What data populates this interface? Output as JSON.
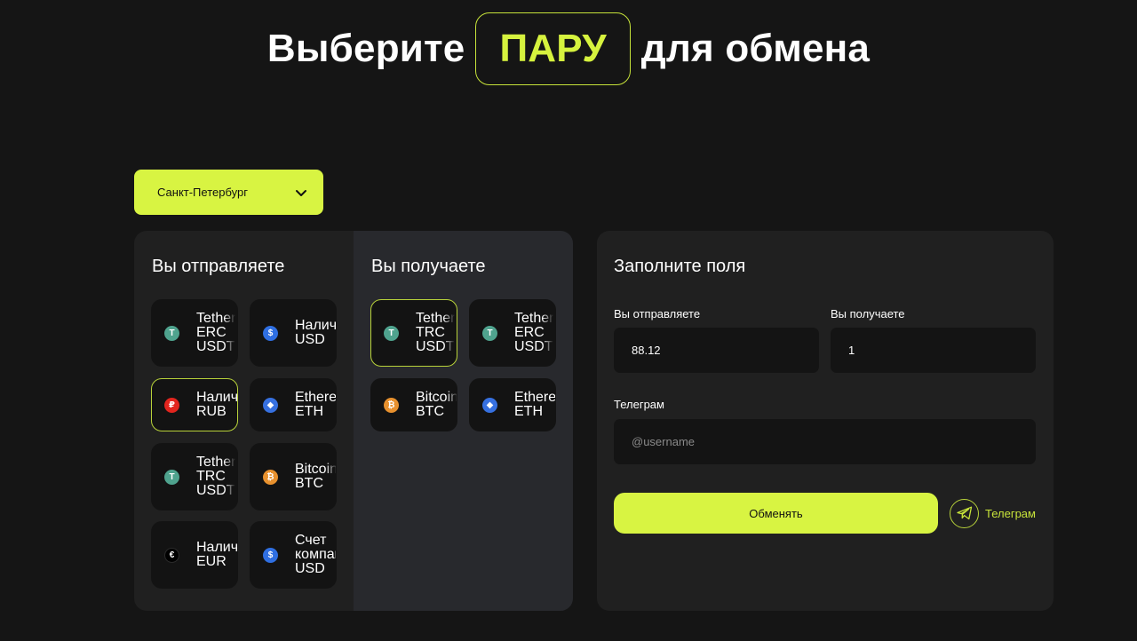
{
  "header": {
    "title_before": "Выберите",
    "title_highlight": "ПАРУ",
    "title_after": "для обмена"
  },
  "city_select": {
    "value": "Санкт-Петербург"
  },
  "send": {
    "title": "Вы отправляете",
    "items": [
      {
        "label": "Tether\nERC\nUSDT",
        "icon": "tether-icon",
        "active": false
      },
      {
        "label": "Наличные\nUSD",
        "icon": "dollar-icon",
        "active": false
      },
      {
        "label": "Наличные\nRUB",
        "icon": "ruble-icon",
        "active": true
      },
      {
        "label": "Ethereum\nETH",
        "icon": "ethereum-icon",
        "active": false
      },
      {
        "label": "Tether\nTRC\nUSDT",
        "icon": "tether-icon",
        "active": false
      },
      {
        "label": "Bitcoin\nBTC",
        "icon": "bitcoin-icon",
        "active": false
      },
      {
        "label": "Наличные\nEUR",
        "icon": "euro-icon",
        "active": false
      },
      {
        "label": "Счет\nкомпании\nUSD",
        "icon": "dollar-icon",
        "active": false
      }
    ]
  },
  "receive": {
    "title": "Вы получаете",
    "items": [
      {
        "label": "Tether\nTRC\nUSDT",
        "icon": "tether-icon",
        "active": true
      },
      {
        "label": "Tether\nERC\nUSDT",
        "icon": "tether-icon",
        "active": false
      },
      {
        "label": "Bitcoin\nBTC",
        "icon": "bitcoin-icon",
        "active": false
      },
      {
        "label": "Ethereum\nETH",
        "icon": "ethereum-icon",
        "active": false
      }
    ]
  },
  "form": {
    "title": "Заполните поля",
    "send_label": "Вы отправляете",
    "send_value": "88.12",
    "receive_label": "Вы получаете",
    "receive_value": "1",
    "telegram_label": "Телеграм",
    "telegram_placeholder": "@username",
    "submit_label": "Обменять",
    "telegram_link_label": "Телеграм"
  },
  "colors": {
    "accent": "#d8f442",
    "background": "#151515",
    "panel": "#202020",
    "panel_alt": "#28292d"
  }
}
